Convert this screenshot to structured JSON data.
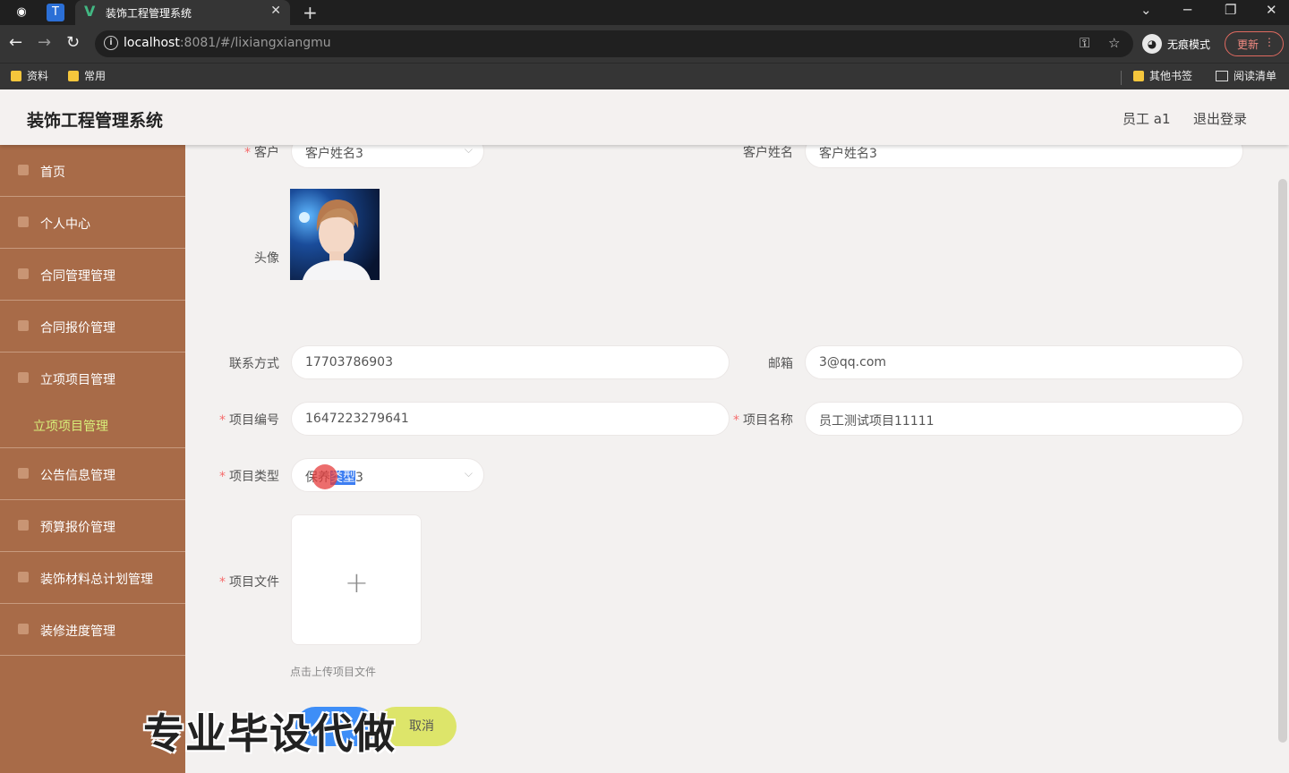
{
  "browser": {
    "tab_title": "装饰工程管理系统",
    "url_host": "localhost",
    "url_rest": ":8081/#/lixiangxiangmu",
    "incognito_label": "无痕模式",
    "update_label": "更新",
    "bookmarks": [
      "资料",
      "常用"
    ],
    "bookmarks_right": [
      "其他书签",
      "阅读清单"
    ]
  },
  "header": {
    "title": "装饰工程管理系统",
    "user": "员工 a1",
    "logout": "退出登录"
  },
  "sidebar": {
    "items": [
      {
        "label": "首页"
      },
      {
        "label": "个人中心"
      },
      {
        "label": "合同管理管理"
      },
      {
        "label": "合同报价管理"
      },
      {
        "label": "立项项目管理"
      },
      {
        "label": "公告信息管理"
      },
      {
        "label": "预算报价管理"
      },
      {
        "label": "装饰材料总计划管理"
      },
      {
        "label": "装修进度管理"
      }
    ],
    "sub_item": "立项项目管理"
  },
  "form": {
    "customer": {
      "label": "客户",
      "value": "客户姓名3"
    },
    "customer_name": {
      "label": "客户姓名",
      "value": "客户姓名3"
    },
    "avatar": {
      "label": "头像"
    },
    "phone": {
      "label": "联系方式",
      "value": "17703786903"
    },
    "email": {
      "label": "邮箱",
      "value": "3@qq.com"
    },
    "project_no": {
      "label": "项目编号",
      "value": "1647223279641"
    },
    "project_name": {
      "label": "项目名称",
      "value": "员工测试项目11111"
    },
    "project_type": {
      "label": "项目类型",
      "value_pre": "保养",
      "value_mid": "类型",
      "value_post": "3"
    },
    "project_file": {
      "label": "项目文件",
      "hint": "点击上传项目文件"
    },
    "cancel_label": "取消"
  },
  "watermark": "专业毕设代做"
}
